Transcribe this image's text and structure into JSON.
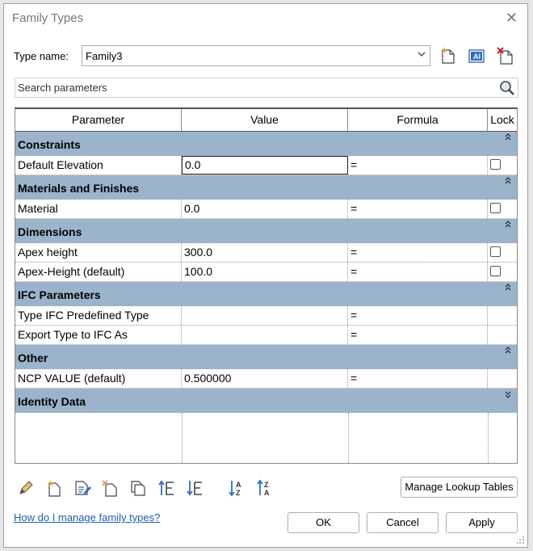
{
  "dialog": {
    "title": "Family Types",
    "close_glyph": "✕"
  },
  "type_name": {
    "label": "Type name:",
    "value": "Family3"
  },
  "toolbar_top": {
    "icons": [
      "new-type-icon",
      "rename-type-icon",
      "delete-type-icon"
    ]
  },
  "search": {
    "placeholder": "Search parameters"
  },
  "grid": {
    "headers": {
      "parameter": "Parameter",
      "value": "Value",
      "formula": "Formula",
      "lock": "Lock"
    },
    "groups": [
      {
        "name": "Constraints",
        "expanded": true,
        "rows": [
          {
            "parameter": "Default Elevation",
            "value": "0.0",
            "formula": "=",
            "lock": true,
            "active": true
          }
        ]
      },
      {
        "name": "Materials and Finishes",
        "expanded": true,
        "rows": [
          {
            "parameter": "Material",
            "value": "0.0",
            "formula": "=",
            "lock": true
          }
        ]
      },
      {
        "name": "Dimensions",
        "expanded": true,
        "rows": [
          {
            "parameter": "Apex height",
            "value": "300.0",
            "formula": "=",
            "lock": true
          },
          {
            "parameter": "Apex-Height (default)",
            "value": "100.0",
            "formula": "=",
            "lock": true
          }
        ]
      },
      {
        "name": "IFC Parameters",
        "expanded": true,
        "rows": [
          {
            "parameter": "Type IFC Predefined Type",
            "value": "",
            "formula": "=",
            "lock": false
          },
          {
            "parameter": "Export Type to IFC As",
            "value": "",
            "formula": "=",
            "lock": false
          }
        ]
      },
      {
        "name": "Other",
        "expanded": true,
        "rows": [
          {
            "parameter": "NCP VALUE (default)",
            "value": "0.500000",
            "formula": "=",
            "lock": false
          }
        ]
      },
      {
        "name": "Identity Data",
        "expanded": false,
        "rows": []
      }
    ]
  },
  "bottom_toolbar": {
    "icons": [
      "edit-parameter-icon",
      "new-parameter-icon",
      "edit-shared-icon",
      "delete-parameter-icon",
      "copy-parameter-icon",
      "move-up-icon",
      "move-down-icon",
      "sort-ascending-icon",
      "sort-descending-icon"
    ],
    "manage_lookup": "Manage Lookup Tables"
  },
  "help_link": "How do I manage family types?",
  "buttons": {
    "ok": "OK",
    "cancel": "Cancel",
    "apply": "Apply"
  },
  "colors": {
    "group_header": "#9cb3cc",
    "link": "#1a5fb4"
  }
}
